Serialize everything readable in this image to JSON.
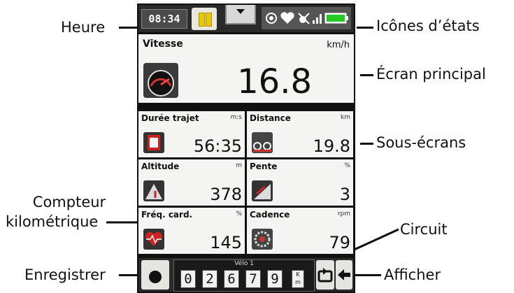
{
  "callouts": {
    "heure": "Heure",
    "icones": "Icônes d’états",
    "ecran_principal": "Écran principal",
    "sous_ecrans": "Sous-écrans",
    "compteur_line1": "Compteur",
    "compteur_line2": "kilométrique",
    "circuit": "Circuit",
    "enregistrer": "Enregistrer",
    "afficher": "Afficher"
  },
  "status_bar": {
    "time": "08:34",
    "icons": [
      "target-icon",
      "heart-icon",
      "no-gps-icon",
      "signal-icon",
      "battery-icon"
    ]
  },
  "main_screen": {
    "label": "Vitesse",
    "unit": "km/h",
    "value": "16.8",
    "icon": "speedometer-icon"
  },
  "sub_screens": [
    {
      "label": "Durée trajet",
      "unit": "m:s",
      "value": "56:35",
      "icon": "timer-icon"
    },
    {
      "label": "Distance",
      "unit": "km",
      "value": "19.8",
      "icon": "cyclist-icon"
    },
    {
      "label": "Altitude",
      "unit": "m",
      "value": "378",
      "icon": "mountain-icon"
    },
    {
      "label": "Pente",
      "unit": "%",
      "value": "3",
      "icon": "slope-icon"
    },
    {
      "label": "Fréq. card.",
      "unit": "%",
      "value": "145",
      "icon": "heart-rate-icon"
    },
    {
      "label": "Cadence",
      "unit": "rpm",
      "value": "79",
      "icon": "crank-icon"
    }
  ],
  "odometer": {
    "label": "Vélo 1",
    "digits": [
      "0",
      "2",
      "6",
      "7",
      "9"
    ],
    "unit_top": "K",
    "unit_bottom": "m"
  },
  "colors": {
    "battery": "#22cc22",
    "pause_bar": "#e6c800",
    "record_dot": "#111111"
  }
}
